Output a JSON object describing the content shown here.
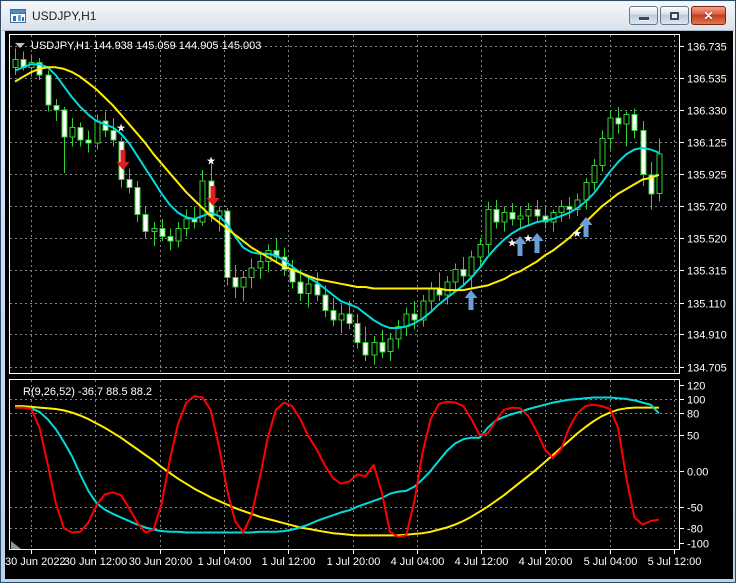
{
  "window": {
    "title": "USDJPY,H1",
    "controls": [
      "minimize",
      "restore",
      "close"
    ]
  },
  "chart_data": {
    "type": "candlestick+oscillator",
    "symbol": "USDJPY",
    "timeframe": "H1",
    "ohlc_header": {
      "symbol_period": "USDJPY,H1",
      "open": "144.938",
      "high": "145.059",
      "low": "144.905",
      "close": "145.003"
    },
    "price_axis": [
      "136.735",
      "136.535",
      "136.330",
      "136.125",
      "135.925",
      "135.720",
      "135.520",
      "135.315",
      "135.110",
      "134.910",
      "134.705"
    ],
    "time_axis": [
      "30 Jun 2022",
      "30 Jun 12:00",
      "30 Jun 20:00",
      "1 Jul 04:00",
      "1 Jul 12:00",
      "1 Jul 20:00",
      "4 Jul 04:00",
      "4 Jul 12:00",
      "4 Jul 20:00",
      "5 Jul 04:00",
      "5 Jul 12:00"
    ],
    "colors": {
      "background": "#000000",
      "grid": "#83838b",
      "candle_outline": "#2fd02f",
      "bull_fill": "#000000",
      "bear_fill": "#ffffff",
      "ma_fast": "#00dcdc",
      "ma_slow": "#ffee00",
      "sell_signal": "#dd1f1f",
      "buy_signal": "#6d9ed8",
      "ind_red": "#ff0000",
      "ind_cyan": "#00dcdc",
      "ind_yellow": "#ffee00",
      "pane_border": "#ffffff"
    },
    "candles": [
      [
        136.6,
        136.72,
        136.55,
        136.65
      ],
      [
        136.65,
        136.7,
        136.58,
        136.6
      ],
      [
        136.6,
        136.68,
        136.55,
        136.63
      ],
      [
        136.63,
        136.66,
        136.52,
        136.55
      ],
      [
        136.55,
        136.58,
        136.32,
        136.36
      ],
      [
        136.36,
        136.4,
        136.26,
        136.33
      ],
      [
        136.33,
        136.35,
        135.93,
        136.16
      ],
      [
        136.16,
        136.28,
        136.1,
        136.22
      ],
      [
        136.22,
        136.25,
        136.1,
        136.14
      ],
      [
        136.14,
        136.2,
        136.06,
        136.12
      ],
      [
        136.12,
        136.3,
        136.08,
        136.26
      ],
      [
        136.26,
        136.32,
        136.16,
        136.2
      ],
      [
        136.2,
        136.28,
        136.1,
        136.14
      ],
      [
        136.13,
        136.16,
        135.84,
        135.89
      ],
      [
        135.89,
        135.96,
        135.8,
        135.84
      ],
      [
        135.84,
        135.88,
        135.62,
        135.67
      ],
      [
        135.67,
        135.72,
        135.52,
        135.56
      ],
      [
        135.56,
        135.62,
        135.47,
        135.58
      ],
      [
        135.58,
        135.64,
        135.5,
        135.53
      ],
      [
        135.53,
        135.58,
        135.44,
        135.5
      ],
      [
        135.5,
        135.62,
        135.46,
        135.58
      ],
      [
        135.58,
        135.7,
        135.53,
        135.64
      ],
      [
        135.64,
        135.72,
        135.58,
        135.62
      ],
      [
        135.62,
        135.95,
        135.6,
        135.88
      ],
      [
        135.88,
        135.99,
        135.62,
        135.66
      ],
      [
        135.66,
        135.72,
        135.56,
        135.69
      ],
      [
        135.69,
        135.71,
        135.22,
        135.27
      ],
      [
        135.27,
        135.35,
        135.14,
        135.21
      ],
      [
        135.21,
        135.31,
        135.12,
        135.27
      ],
      [
        135.27,
        135.39,
        135.2,
        135.33
      ],
      [
        135.33,
        135.43,
        135.26,
        135.37
      ],
      [
        135.37,
        135.48,
        135.3,
        135.44
      ],
      [
        135.44,
        135.52,
        135.36,
        135.4
      ],
      [
        135.4,
        135.46,
        135.28,
        135.32
      ],
      [
        135.32,
        135.38,
        135.2,
        135.24
      ],
      [
        135.24,
        135.32,
        135.12,
        135.17
      ],
      [
        135.17,
        135.27,
        135.08,
        135.23
      ],
      [
        135.23,
        135.3,
        135.12,
        135.16
      ],
      [
        135.16,
        135.22,
        135.02,
        135.06
      ],
      [
        135.06,
        135.14,
        134.96,
        135.0
      ],
      [
        135.0,
        135.1,
        134.92,
        135.04
      ],
      [
        135.04,
        135.12,
        134.94,
        134.98
      ],
      [
        134.98,
        135.04,
        134.82,
        134.86
      ],
      [
        134.86,
        134.96,
        134.74,
        134.78
      ],
      [
        134.78,
        134.9,
        134.72,
        134.86
      ],
      [
        134.86,
        134.94,
        134.76,
        134.8
      ],
      [
        134.8,
        134.92,
        134.74,
        134.88
      ],
      [
        134.88,
        135.0,
        134.82,
        134.96
      ],
      [
        134.96,
        135.08,
        134.9,
        135.04
      ],
      [
        135.04,
        135.12,
        134.94,
        135.0
      ],
      [
        135.0,
        135.16,
        134.96,
        135.12
      ],
      [
        135.12,
        135.24,
        135.06,
        135.2
      ],
      [
        135.2,
        135.3,
        135.12,
        135.16
      ],
      [
        135.16,
        135.28,
        135.1,
        135.24
      ],
      [
        135.24,
        135.36,
        135.18,
        135.32
      ],
      [
        135.32,
        135.4,
        135.22,
        135.28
      ],
      [
        135.28,
        135.44,
        135.2,
        135.4
      ],
      [
        135.4,
        135.52,
        135.34,
        135.48
      ],
      [
        135.48,
        135.75,
        135.42,
        135.7
      ],
      [
        135.7,
        135.76,
        135.58,
        135.62
      ],
      [
        135.62,
        135.72,
        135.56,
        135.68
      ],
      [
        135.68,
        135.74,
        135.6,
        135.64
      ],
      [
        135.64,
        135.72,
        135.58,
        135.66
      ],
      [
        135.66,
        135.74,
        135.6,
        135.7
      ],
      [
        135.7,
        135.76,
        135.62,
        135.66
      ],
      [
        135.66,
        135.72,
        135.58,
        135.62
      ],
      [
        135.62,
        135.7,
        135.56,
        135.68
      ],
      [
        135.68,
        135.76,
        135.62,
        135.72
      ],
      [
        135.72,
        135.78,
        135.64,
        135.7
      ],
      [
        135.7,
        135.8,
        135.66,
        135.76
      ],
      [
        135.76,
        135.9,
        135.7,
        135.87
      ],
      [
        135.87,
        136.02,
        135.82,
        135.98
      ],
      [
        135.98,
        136.2,
        135.94,
        136.15
      ],
      [
        136.15,
        136.33,
        136.08,
        136.28
      ],
      [
        136.28,
        136.35,
        136.18,
        136.24
      ],
      [
        136.24,
        136.32,
        136.1,
        136.3
      ],
      [
        136.3,
        136.34,
        136.15,
        136.2
      ],
      [
        136.2,
        136.26,
        135.85,
        135.92
      ],
      [
        135.92,
        136.0,
        135.7,
        135.8
      ],
      [
        135.8,
        136.15,
        135.75,
        136.05
      ]
    ],
    "ma_fast": [
      136.58,
      136.6,
      136.62,
      136.62,
      136.6,
      136.55,
      136.48,
      136.41,
      136.35,
      136.3,
      136.26,
      136.24,
      136.22,
      136.18,
      136.12,
      136.04,
      135.96,
      135.88,
      135.8,
      135.73,
      135.68,
      135.65,
      135.64,
      135.66,
      135.68,
      135.66,
      135.61,
      135.53,
      135.46,
      135.43,
      135.42,
      135.42,
      135.41,
      135.38,
      135.34,
      135.3,
      135.27,
      135.24,
      135.2,
      135.16,
      135.12,
      135.1,
      135.08,
      135.04,
      135.0,
      134.97,
      134.95,
      134.95,
      134.96,
      134.98,
      135.01,
      135.05,
      135.1,
      135.14,
      135.18,
      135.22,
      135.27,
      135.33,
      135.4,
      135.46,
      135.51,
      135.55,
      135.58,
      135.6,
      135.62,
      135.63,
      135.64,
      135.66,
      135.68,
      135.71,
      135.75,
      135.8,
      135.87,
      135.94,
      136.0,
      136.05,
      136.08,
      136.09,
      136.08,
      136.06
    ],
    "ma_slow": [
      136.51,
      136.54,
      136.57,
      136.59,
      136.6,
      136.6,
      136.59,
      136.57,
      136.54,
      136.5,
      136.46,
      136.41,
      136.36,
      136.3,
      136.24,
      136.18,
      136.12,
      136.05,
      135.99,
      135.93,
      135.87,
      135.81,
      135.76,
      135.71,
      135.66,
      135.62,
      135.58,
      135.54,
      135.5,
      135.46,
      135.43,
      135.4,
      135.37,
      135.34,
      135.32,
      135.3,
      135.28,
      135.26,
      135.25,
      135.24,
      135.23,
      135.22,
      135.21,
      135.21,
      135.2,
      135.2,
      135.2,
      135.2,
      135.2,
      135.2,
      135.2,
      135.2,
      135.2,
      135.19,
      135.19,
      135.19,
      135.2,
      135.21,
      135.22,
      135.24,
      135.26,
      135.29,
      135.31,
      135.34,
      135.37,
      135.41,
      135.44,
      135.48,
      135.52,
      135.57,
      135.62,
      135.67,
      135.72,
      135.76,
      135.8,
      135.83,
      135.86,
      135.89,
      135.9,
      135.92
    ],
    "signals": {
      "sell": [
        {
          "index": 13,
          "star_price": 136.22,
          "arrow_price": 136.02
        },
        {
          "index": 24,
          "star_price": 136.01,
          "arrow_price": 135.79
        }
      ],
      "buy_arrows": [
        {
          "index": 56,
          "price": 135.12
        },
        {
          "index": 62,
          "price": 135.46
        },
        {
          "index": 64,
          "price": 135.48
        },
        {
          "index": 70,
          "price": 135.58
        }
      ],
      "buy_stars": [
        {
          "index": 61,
          "price": 135.49
        },
        {
          "index": 63,
          "price": 135.52
        },
        {
          "index": 69,
          "price": 135.55
        }
      ]
    },
    "indicator": {
      "label": "R(9,26,52) -36.7 88.5 88.2",
      "axis_labels": [
        "120",
        "100",
        "80",
        "50",
        "0.00",
        "-50",
        "-80",
        "-100"
      ],
      "axis_values": [
        120,
        100,
        80,
        50,
        0,
        -50,
        -80,
        -100
      ],
      "grid_values": [
        100,
        80,
        50,
        0,
        -50,
        -80
      ],
      "values_red": [
        88,
        88,
        86,
        60,
        10,
        -45,
        -80,
        -86,
        -85,
        -72,
        -48,
        -33,
        -30,
        -34,
        -52,
        -72,
        -86,
        -82,
        -45,
        15,
        65,
        95,
        104,
        102,
        85,
        35,
        -25,
        -70,
        -86,
        -62,
        -12,
        45,
        85,
        95,
        90,
        72,
        48,
        30,
        8,
        -10,
        -18,
        -15,
        -5,
        -8,
        8,
        -30,
        -85,
        -92,
        -90,
        -42,
        25,
        72,
        93,
        96,
        95,
        90,
        72,
        50,
        52,
        70,
        85,
        88,
        87,
        76,
        55,
        30,
        18,
        30,
        60,
        80,
        90,
        92,
        90,
        86,
        60,
        -10,
        -65,
        -75,
        -70,
        -68
      ],
      "values_cyan": [
        88,
        88,
        87,
        82,
        72,
        58,
        40,
        20,
        -5,
        -28,
        -45,
        -54,
        -60,
        -65,
        -70,
        -75,
        -79,
        -82,
        -84,
        -85,
        -85,
        -86,
        -86,
        -86,
        -86,
        -86,
        -86,
        -86,
        -86,
        -86,
        -85,
        -85,
        -85,
        -84,
        -82,
        -79,
        -75,
        -70,
        -66,
        -62,
        -58,
        -55,
        -50,
        -46,
        -42,
        -38,
        -32,
        -29,
        -28,
        -22,
        -12,
        0,
        14,
        28,
        38,
        44,
        46,
        46,
        60,
        70,
        75,
        79,
        82,
        86,
        89,
        92,
        95,
        97,
        99,
        100,
        101,
        102,
        102,
        102,
        101,
        100,
        98,
        95,
        92,
        80
      ],
      "values_yellow": [
        90,
        90,
        89,
        88,
        87,
        86,
        84,
        81,
        77,
        72,
        66,
        60,
        53,
        46,
        38,
        30,
        22,
        14,
        5,
        -3,
        -11,
        -18,
        -25,
        -31,
        -37,
        -42,
        -47,
        -52,
        -56,
        -60,
        -64,
        -67,
        -70,
        -73,
        -76,
        -79,
        -81,
        -83,
        -85,
        -87,
        -88,
        -89,
        -90,
        -90,
        -90,
        -90,
        -90,
        -90,
        -89,
        -88,
        -87,
        -85,
        -82,
        -79,
        -75,
        -70,
        -64,
        -57,
        -50,
        -42,
        -34,
        -25,
        -16,
        -7,
        2,
        12,
        22,
        32,
        42,
        52,
        61,
        69,
        76,
        81,
        85,
        87,
        88,
        88,
        88,
        88
      ]
    }
  }
}
